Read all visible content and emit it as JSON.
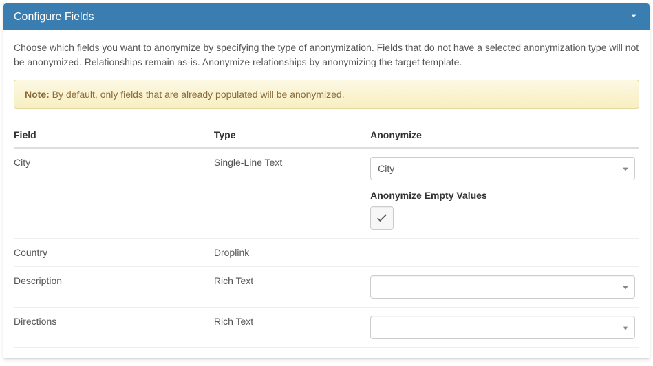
{
  "panel": {
    "title": "Configure Fields"
  },
  "description": "Choose which fields you want to anonymize by specifying the type of anonymization. Fields that do not have a selected anonymization type will not be anonymized. Relationships remain as-is. Anonymize relationships by anonymizing the target template.",
  "note": {
    "label": "Note:",
    "text": "By default, only fields that are already populated will be anonymized."
  },
  "table": {
    "headers": {
      "field": "Field",
      "type": "Type",
      "anonymize": "Anonymize"
    },
    "rows": [
      {
        "field": "City",
        "type": "Single-Line Text",
        "anonymize_selected": "City",
        "empty_values_label": "Anonymize Empty Values",
        "empty_values_checked": true,
        "has_select": true,
        "has_empty_toggle": true
      },
      {
        "field": "Country",
        "type": "Droplink",
        "has_select": false,
        "has_empty_toggle": false
      },
      {
        "field": "Description",
        "type": "Rich Text",
        "anonymize_selected": "",
        "has_select": true,
        "has_empty_toggle": false
      },
      {
        "field": "Directions",
        "type": "Rich Text",
        "anonymize_selected": "",
        "has_select": true,
        "has_empty_toggle": false
      }
    ]
  }
}
